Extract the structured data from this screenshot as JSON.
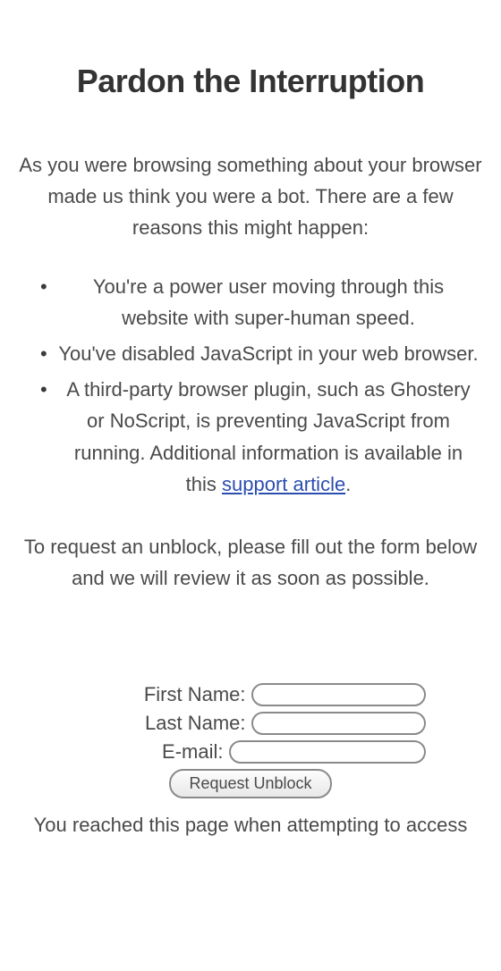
{
  "title": "Pardon the Interruption",
  "intro": "As you were browsing something about your browser made us think you were a bot. There are a few reasons this might happen:",
  "reasons": [
    "You're a power user moving through this website with super-human speed.",
    "You've disabled JavaScript in your web browser.",
    {
      "text_before": "A third-party browser plugin, such as Ghostery or NoScript, is preventing JavaScript from running. Additional information is available in this ",
      "link_text": "support article",
      "text_after": "."
    }
  ],
  "instruction": "To request an unblock, please fill out the form below and we will review it as soon as possible.",
  "form": {
    "first_name_label": "First Name:",
    "last_name_label": "Last Name:",
    "email_label": "E-mail:",
    "submit_label": "Request Unblock"
  },
  "footer": "You reached this page when attempting to access"
}
